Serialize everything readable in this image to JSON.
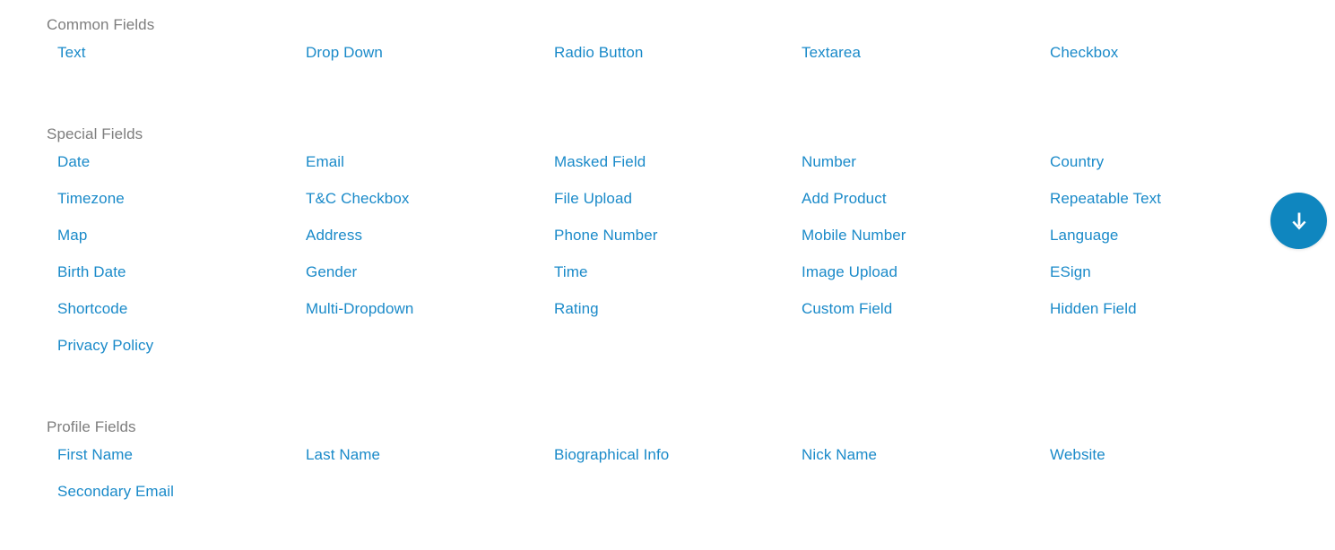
{
  "theme": {
    "background": "#ffffff",
    "link_color": "#1a8ac9",
    "section_title_color": "#7d7d7d",
    "accent_color": "#0f86bf",
    "fab_icon_color": "#ffffff"
  },
  "sections": [
    {
      "id": "common-fields",
      "title": "Common Fields",
      "rows": [
        [
          "Text",
          "Drop Down",
          "Radio Button",
          "Textarea",
          "Checkbox"
        ]
      ]
    },
    {
      "id": "special-fields",
      "title": "Special Fields",
      "rows": [
        [
          "Date",
          "Email",
          "Masked Field",
          "Number",
          "Country"
        ],
        [
          "Timezone",
          "T&C Checkbox",
          "File Upload",
          "Add Product",
          "Repeatable Text"
        ],
        [
          "Map",
          "Address",
          "Phone Number",
          "Mobile Number",
          "Language"
        ],
        [
          "Birth Date",
          "Gender",
          "Time",
          "Image Upload",
          "ESign"
        ],
        [
          "Shortcode",
          "Multi-Dropdown",
          "Rating",
          "Custom Field",
          "Hidden Field"
        ],
        [
          "Privacy Policy",
          "",
          "",
          "",
          ""
        ]
      ]
    },
    {
      "id": "profile-fields",
      "title": "Profile Fields",
      "rows": [
        [
          "First Name",
          "Last Name",
          "Biographical Info",
          "Nick Name",
          "Website"
        ],
        [
          "Secondary Email",
          "",
          "",
          "",
          ""
        ]
      ]
    }
  ],
  "floating_button": {
    "name": "scroll-down-button",
    "icon": "arrow-down-icon",
    "label": ""
  }
}
